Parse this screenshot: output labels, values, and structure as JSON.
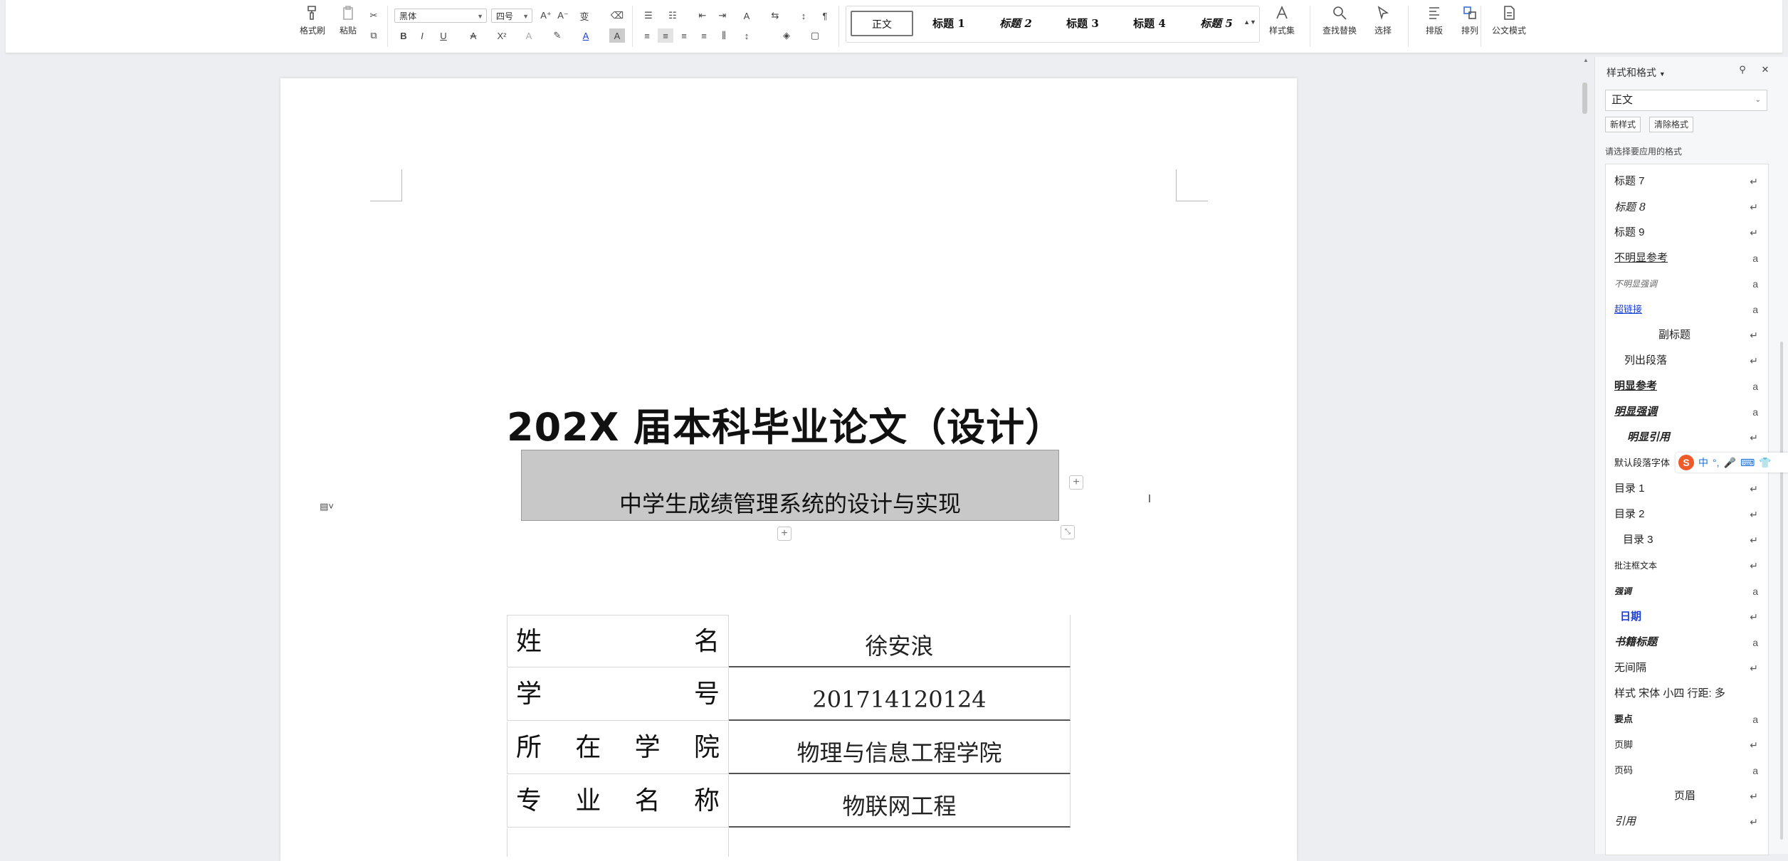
{
  "ribbon": {
    "format_painter": "格式刷",
    "paste": "粘贴",
    "font_name": "黑体",
    "font_size": "四号",
    "styles": [
      "正文",
      "标题 1",
      "标题 2",
      "标题 3",
      "标题 4",
      "标题 5"
    ],
    "style_set": "样式集",
    "find_replace": "查找替换",
    "select": "选择",
    "arrange": "排版",
    "sort": "排列",
    "official_mode": "公文模式"
  },
  "document": {
    "title": "202X 届本科毕业论文（设计）",
    "subtitle": "中学生成绩管理系统的设计与实现",
    "info_rows": [
      {
        "label": [
          "姓",
          "名"
        ],
        "value": "徐安浪"
      },
      {
        "label": [
          "学",
          "号"
        ],
        "value": "201714120124"
      },
      {
        "label": [
          "所",
          "在",
          "学",
          "院"
        ],
        "value": "物理与信息工程学院"
      },
      {
        "label": [
          "专",
          "业",
          "名",
          "称"
        ],
        "value": "物联网工程"
      }
    ]
  },
  "pane": {
    "title": "样式和格式",
    "current_style": "正文",
    "new_style": "新样式",
    "clear_format": "清除格式",
    "hint": "请选择要应用的格式",
    "items": [
      {
        "name": "标题 7",
        "mark": "↵"
      },
      {
        "name": "标题 8",
        "mark": "↵"
      },
      {
        "name": "标题 9",
        "mark": "↵"
      },
      {
        "name": "不明显参考",
        "mark": "a"
      },
      {
        "name": "不明显强调",
        "mark": "a"
      },
      {
        "name": "超链接",
        "mark": "a"
      },
      {
        "name": "副标题",
        "mark": "↵"
      },
      {
        "name": "列出段落",
        "mark": "↵"
      },
      {
        "name": "明显参考",
        "mark": "a"
      },
      {
        "name": "明显强调",
        "mark": "a"
      },
      {
        "name": "明显引用",
        "mark": "↵"
      },
      {
        "name": "默认段落字体",
        "mark": "a"
      },
      {
        "name": "目录 1",
        "mark": "↵"
      },
      {
        "name": "目录 2",
        "mark": "↵"
      },
      {
        "name": "目录 3",
        "mark": "↵"
      },
      {
        "name": "批注框文本",
        "mark": "↵"
      },
      {
        "name": "强调",
        "mark": "a"
      },
      {
        "name": "日期",
        "mark": "↵"
      },
      {
        "name": "书籍标题",
        "mark": "a"
      },
      {
        "name": "无间隔",
        "mark": "↵"
      },
      {
        "name": "样式 宋体 小四 行距: 多",
        "mark": ""
      },
      {
        "name": "要点",
        "mark": "a"
      },
      {
        "name": "页脚",
        "mark": "↵"
      },
      {
        "name": "页码",
        "mark": "a"
      },
      {
        "name": "页眉",
        "mark": "↵"
      },
      {
        "name": "引用",
        "mark": "↵"
      }
    ]
  },
  "ime": {
    "lang": "中"
  }
}
